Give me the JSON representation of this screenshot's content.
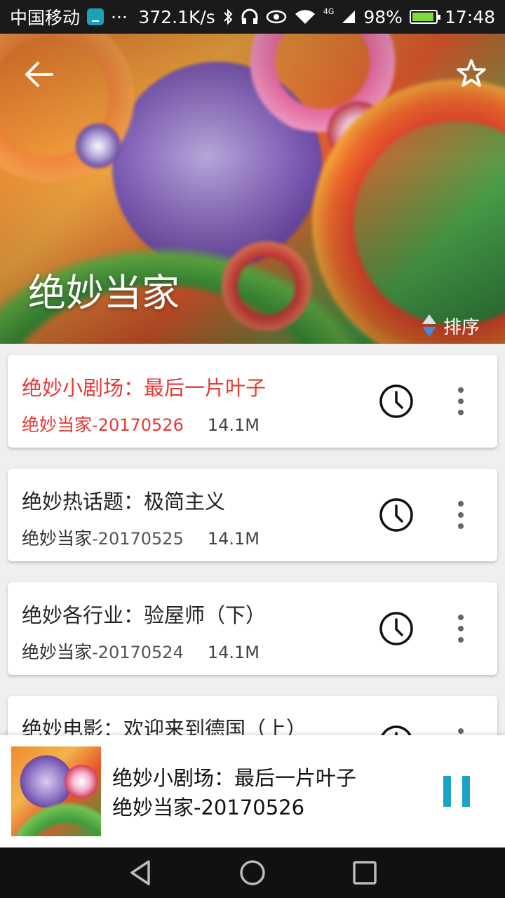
{
  "status_bar": {
    "carrier": "中国移动",
    "more": "···",
    "speed": "372.1K/s",
    "network": "4G",
    "battery": "98%",
    "time": "17:48"
  },
  "header": {
    "title": "绝妙当家",
    "sort_label": "排序"
  },
  "episodes": [
    {
      "title": "绝妙小剧场：最后一片叶子",
      "show": "绝妙当家",
      "date": "-20170526",
      "size": "14.1M",
      "active": true
    },
    {
      "title": "绝妙热话题：极简主义",
      "show": "绝妙当家",
      "date": "-20170525",
      "size": "14.1M",
      "active": false
    },
    {
      "title": "绝妙各行业：验屋师（下）",
      "show": "绝妙当家",
      "date": "-20170524",
      "size": "14.1M",
      "active": false
    },
    {
      "title": "绝妙电影：欢迎来到德国（上）",
      "show": "",
      "date": "",
      "size": "",
      "active": false
    }
  ],
  "player": {
    "title": "绝妙小剧场：最后一片叶子",
    "subtitle": "绝妙当家-20170526",
    "state": "playing"
  },
  "colors": {
    "active_text": "#e53935",
    "accent": "#1aa3c8"
  },
  "icons": {
    "back": "arrow-left-icon",
    "favorite": "star-outline-icon",
    "sort": "sort-arrows-icon",
    "clock": "clock-icon",
    "more": "more-vertical-icon",
    "pause": "pause-icon"
  }
}
